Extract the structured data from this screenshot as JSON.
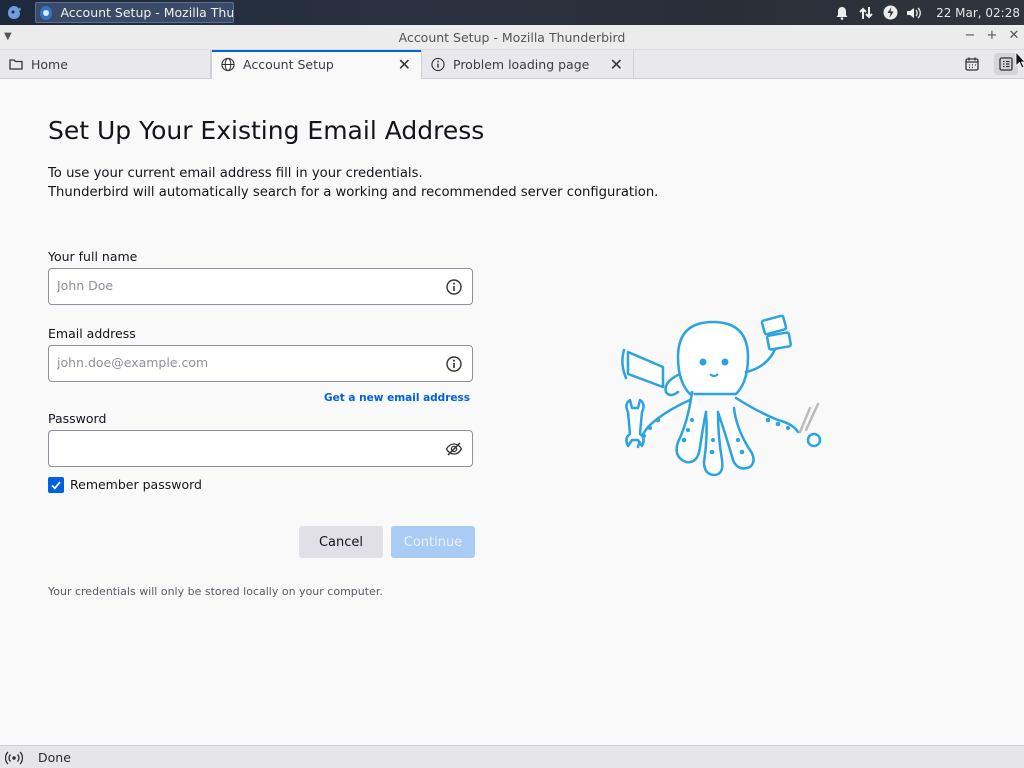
{
  "os": {
    "taskbar_title": "Account Setup - Mozilla Thun...",
    "clock": "22 Mar, 02:28",
    "tray_icons": [
      "bell-icon",
      "network-transfer-icon",
      "power-icon",
      "volume-icon"
    ]
  },
  "window": {
    "title": "Account Setup - Mozilla Thunderbird",
    "controls": {
      "minimize": "−",
      "maximize": "+",
      "close": "✕"
    }
  },
  "tabs": [
    {
      "label": "Home",
      "icon": "folder-icon",
      "active": false,
      "closable": false
    },
    {
      "label": "Account Setup",
      "icon": "globe-icon",
      "active": true,
      "closable": true
    },
    {
      "label": "Problem loading page",
      "icon": "info-icon",
      "active": false,
      "closable": true
    }
  ],
  "toolbar_icons": [
    "calendar-icon",
    "tasks-icon"
  ],
  "form": {
    "heading": "Set Up Your Existing Email Address",
    "intro_line1": "To use your current email address fill in your credentials.",
    "intro_line2": "Thunderbird will automatically search for a working and recommended server configuration.",
    "name_label": "Your full name",
    "name_placeholder": "John Doe",
    "name_value": "",
    "email_label": "Email address",
    "email_placeholder": "john.doe@example.com",
    "email_value": "",
    "new_email_link": "Get a new email address",
    "password_label": "Password",
    "password_value": "",
    "remember_label": "Remember password",
    "remember_checked": true,
    "cancel_label": "Cancel",
    "continue_label": "Continue",
    "footnote": "Your credentials will only be stored locally on your computer."
  },
  "status": {
    "text": "Done"
  },
  "colors": {
    "accent": "#0060df",
    "continue_disabled": "#a9cbf4",
    "mascot": "#2aa3e0"
  }
}
